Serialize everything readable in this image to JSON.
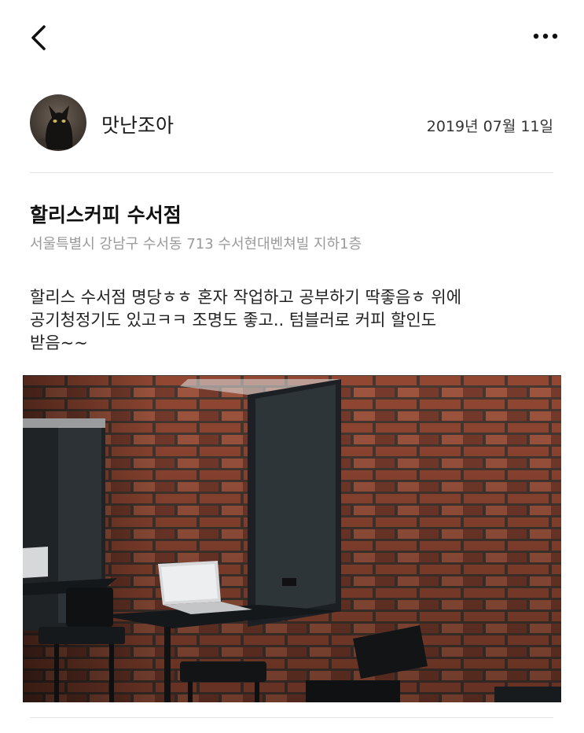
{
  "topbar": {
    "back_icon": "chevron-left-icon",
    "more_icon": "more-horizontal-icon"
  },
  "author": {
    "name": "맛난조아",
    "date": "2019년 07월 11일",
    "avatar_icon": "black-cat-avatar"
  },
  "place": {
    "name": "할리스커피 수서점",
    "address": "서울특별시 강남구 수서동 713 수서현대벤쳐빌 지하1층"
  },
  "review": {
    "lines": [
      "할리스 수서점 명당ㅎㅎ 혼자 작업하고 공부하기 딱좋음ㅎ 위에",
      "공기청정기도 있고ㅋㅋ 조명도 좋고.. 텀블러로 커피 할인도",
      "받음~~"
    ]
  },
  "photo": {
    "subject": "cafe-interior-photo"
  },
  "colors": {
    "text": "#1a1a1a",
    "muted": "#9a9a9a",
    "divider": "#e3e3e3",
    "brick": "#8a4530"
  }
}
